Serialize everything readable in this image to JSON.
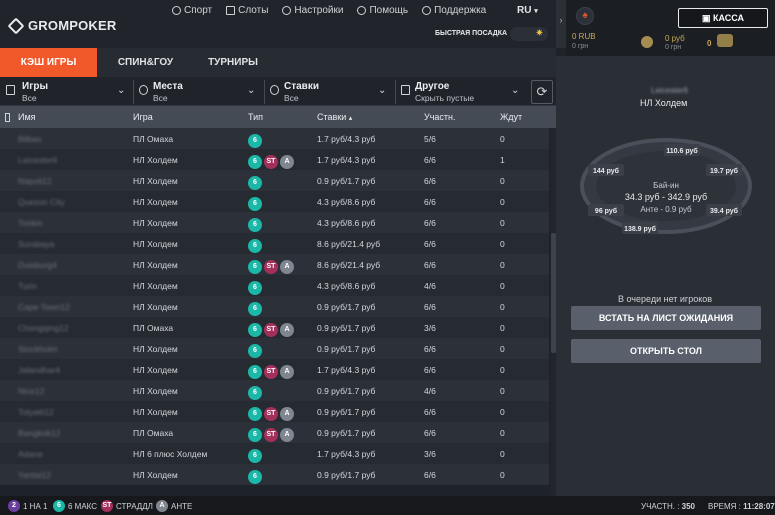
{
  "brand": "GROMPOKER",
  "nav": [
    {
      "label": "Спорт",
      "icon": "football-icon"
    },
    {
      "label": "Слоты",
      "icon": "slot-icon"
    },
    {
      "label": "Настройки",
      "icon": "gear-icon"
    },
    {
      "label": "Помощь",
      "icon": "help-icon"
    },
    {
      "label": "Поддержка",
      "icon": "headset-icon"
    }
  ],
  "lang": "RU",
  "fast_seat": "БЫСТРАЯ ПОСАДКА",
  "account": {
    "balance_rub": "0 RUB",
    "balance_grn": "0 грн",
    "balance2": "0 руб",
    "balance2b": "0 грн",
    "tokens": "0",
    "cashier": "КАССА"
  },
  "tabs": [
    "КЭШ ИГРЫ",
    "СПИН&ГОУ",
    "ТУРНИРЫ"
  ],
  "filters": [
    {
      "title": "Игры",
      "value": "Все"
    },
    {
      "title": "Места",
      "value": "Все"
    },
    {
      "title": "Ставки",
      "value": "Все"
    },
    {
      "title": "Другое",
      "value": "Скрыть пустые"
    }
  ],
  "columns": {
    "name": "Имя",
    "game": "Игра",
    "type": "Тип",
    "stakes": "Ставки",
    "players": "Участн.",
    "waiting": "Ждут"
  },
  "rows": [
    {
      "name": "Bilbao",
      "game": "ПЛ Омаха",
      "st": false,
      "a": false,
      "stakes": "1.7 руб/4.3 руб",
      "players": "5/6",
      "waiting": "0"
    },
    {
      "name": "Leicester6",
      "game": "НЛ Холдем",
      "st": true,
      "a": true,
      "stakes": "1.7 руб/4.3 руб",
      "players": "6/6",
      "waiting": "1"
    },
    {
      "name": "Napoli12",
      "game": "НЛ Холдем",
      "st": false,
      "a": false,
      "stakes": "0.9 руб/1.7 руб",
      "players": "6/6",
      "waiting": "0"
    },
    {
      "name": "Quezon City",
      "game": "НЛ Холдем",
      "st": false,
      "a": false,
      "stakes": "4.3 руб/8.6 руб",
      "players": "6/6",
      "waiting": "0"
    },
    {
      "name": "Tonkin",
      "game": "НЛ Холдем",
      "st": false,
      "a": false,
      "stakes": "4.3 руб/8.6 руб",
      "players": "6/6",
      "waiting": "0"
    },
    {
      "name": "Surabaya",
      "game": "НЛ Холдем",
      "st": false,
      "a": false,
      "stakes": "8.6 руб/21.4 руб",
      "players": "6/6",
      "waiting": "0"
    },
    {
      "name": "Duisburg4",
      "game": "НЛ Холдем",
      "st": true,
      "a": true,
      "stakes": "8.6 руб/21.4 руб",
      "players": "6/6",
      "waiting": "0"
    },
    {
      "name": "Turin",
      "game": "НЛ Холдем",
      "st": false,
      "a": false,
      "stakes": "4.3 руб/8.6 руб",
      "players": "4/6",
      "waiting": "0"
    },
    {
      "name": "Cape Town12",
      "game": "НЛ Холдем",
      "st": false,
      "a": false,
      "stakes": "0.9 руб/1.7 руб",
      "players": "6/6",
      "waiting": "0"
    },
    {
      "name": "Chongqing12",
      "game": "ПЛ Омаха",
      "st": true,
      "a": true,
      "stakes": "0.9 руб/1.7 руб",
      "players": "3/6",
      "waiting": "0"
    },
    {
      "name": "Stockholm",
      "game": "НЛ Холдем",
      "st": false,
      "a": false,
      "stakes": "0.9 руб/1.7 руб",
      "players": "6/6",
      "waiting": "0"
    },
    {
      "name": "Jalandhar4",
      "game": "НЛ Холдем",
      "st": true,
      "a": true,
      "stakes": "1.7 руб/4.3 руб",
      "players": "6/6",
      "waiting": "0"
    },
    {
      "name": "Nice12",
      "game": "НЛ Холдем",
      "st": false,
      "a": false,
      "stakes": "0.9 руб/1.7 руб",
      "players": "4/6",
      "waiting": "0"
    },
    {
      "name": "Tolyatti12",
      "game": "НЛ Холдем",
      "st": true,
      "a": true,
      "stakes": "0.9 руб/1.7 руб",
      "players": "6/6",
      "waiting": "0"
    },
    {
      "name": "Bangkok12",
      "game": "ПЛ Омаха",
      "st": true,
      "a": true,
      "stakes": "0.9 руб/1.7 руб",
      "players": "6/6",
      "waiting": "0"
    },
    {
      "name": "Adana",
      "game": "НЛ 6 плюс Холдем",
      "st": false,
      "a": false,
      "stakes": "1.7 руб/4.3 руб",
      "players": "3/6",
      "waiting": "0"
    },
    {
      "name": "Yantai12",
      "game": "НЛ Холдем",
      "st": false,
      "a": false,
      "stakes": "0.9 руб/1.7 руб",
      "players": "6/6",
      "waiting": "0"
    }
  ],
  "legend": [
    {
      "badge": "2",
      "label": "1 НА 1",
      "color": "#6b3fa0"
    },
    {
      "badge": "6",
      "label": "6 МАКС",
      "color": "#1bb7a7"
    },
    {
      "badge": "ST",
      "label": "СТРАДДЛ",
      "color": "#a3305a"
    },
    {
      "badge": "A",
      "label": "АНТЕ",
      "color": "#7f8690"
    }
  ],
  "status": {
    "players_label": "УЧАСТН. :",
    "players": "350",
    "time_label": "ВРЕМЯ :",
    "time": "11:28:07"
  },
  "side": {
    "table_name": "Leicester6",
    "table_type": "НЛ Холдем",
    "seats": [
      "110.6 руб",
      "144 руб",
      "19.7 руб",
      "96 руб",
      "39.4 руб",
      "138.9 руб"
    ],
    "buyin_label": "Бай-ин",
    "buyin": "34.3 руб - 342.9 руб",
    "ante": "Анте - 0.9 руб",
    "queue": "В очереди нет игроков",
    "waitlist_btn": "ВСТАТЬ НА ЛИСТ ОЖИДАНИЯ",
    "open_btn": "ОТКРЫТЬ СТОЛ"
  },
  "colors": {
    "accent": "#f1592a",
    "badge6": "#1bb7a7",
    "badgeST": "#a3305a",
    "badgeA": "#7f8690"
  }
}
